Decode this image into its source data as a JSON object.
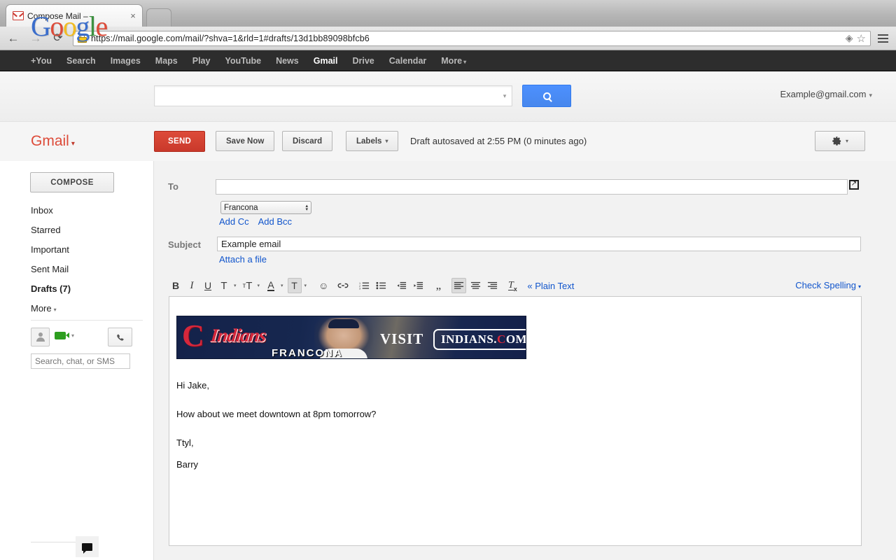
{
  "browser": {
    "tab_title": "Compose Mail –",
    "tab_close": "×",
    "back": "←",
    "forward": "→",
    "reload": "⟳",
    "url": "https://mail.google.com/mail/?shva=1&rld=1#drafts/13d1bb89098bfcb6",
    "bookmark_star": "☆",
    "extension_icon": "◈",
    "favicon_name": "gmail-favicon"
  },
  "gbar": {
    "links": [
      {
        "label": "+You",
        "active": false
      },
      {
        "label": "Search",
        "active": false
      },
      {
        "label": "Images",
        "active": false
      },
      {
        "label": "Maps",
        "active": false
      },
      {
        "label": "Play",
        "active": false
      },
      {
        "label": "YouTube",
        "active": false
      },
      {
        "label": "News",
        "active": false
      },
      {
        "label": "Gmail",
        "active": true
      },
      {
        "label": "Drive",
        "active": false
      },
      {
        "label": "Calendar",
        "active": false
      },
      {
        "label": "More",
        "active": false,
        "caret": true
      }
    ],
    "caret": "▾"
  },
  "header": {
    "logo_letters": [
      {
        "ch": "G",
        "color": "blue"
      },
      {
        "ch": "o",
        "color": "red"
      },
      {
        "ch": "o",
        "color": "yellow"
      },
      {
        "ch": "g",
        "color": "blue"
      },
      {
        "ch": "l",
        "color": "green"
      },
      {
        "ch": "e",
        "color": "red"
      }
    ],
    "search_value": "",
    "search_placeholder": "",
    "search_button_icon": "search-icon",
    "account": "Example@gmail.com",
    "account_caret": "▾"
  },
  "actionbar": {
    "gmail_label": "Gmail",
    "gmail_caret": "▾",
    "send_label": "SEND",
    "save_label": "Save Now",
    "discard_label": "Discard",
    "labels_label": "Labels",
    "labels_caret": "▾",
    "autosave_text": "Draft autosaved at 2:55 PM (0 minutes ago)",
    "settings_icon": "gear-icon",
    "settings_caret": "▾"
  },
  "sidebar": {
    "compose_label": "COMPOSE",
    "items": [
      {
        "label": "Inbox",
        "bold": false
      },
      {
        "label": "Starred",
        "bold": false
      },
      {
        "label": "Important",
        "bold": false
      },
      {
        "label": "Sent Mail",
        "bold": false
      },
      {
        "label": "Drafts (7)",
        "bold": true
      },
      {
        "label": "More",
        "bold": false,
        "caret": true
      }
    ],
    "more_caret": "▾",
    "chat_search_placeholder": "Search, chat, or SMS",
    "chat_search_value": "",
    "video_caret": "▾",
    "phone_icon": "phone-icon",
    "chat_bubble_icon": "chat-bubble-icon"
  },
  "compose": {
    "to_label": "To",
    "to_value": "",
    "to_placeholder": "",
    "popout_icon": "popout-icon",
    "from_select_value": "Francona",
    "add_cc": "Add Cc",
    "add_bcc": "Add Bcc",
    "subject_label": "Subject",
    "subject_value": "Example email",
    "attach_label": "Attach a file",
    "plain_text_label": "« Plain Text",
    "check_spelling_label": "Check Spelling",
    "check_spelling_caret": "▾",
    "toolbar": [
      {
        "name": "bold-icon",
        "glyph": "B",
        "style": "bold",
        "caret": false,
        "active": false
      },
      {
        "name": "italic-icon",
        "glyph": "I",
        "style": "italic",
        "caret": false,
        "active": false
      },
      {
        "name": "underline-icon",
        "glyph": "U",
        "style": "underline",
        "caret": false,
        "active": false
      },
      {
        "name": "font-family-icon",
        "glyph": "T",
        "style": "plain",
        "caret": true,
        "active": false
      },
      {
        "name": "font-size-icon",
        "glyph": "ᴛT",
        "style": "plain",
        "caret": true,
        "active": false
      },
      {
        "name": "text-color-icon",
        "glyph": "A",
        "style": "colorA",
        "caret": true,
        "active": false
      },
      {
        "name": "highlight-color-icon",
        "glyph": "T",
        "style": "plain",
        "caret": true,
        "active": true
      },
      {
        "name": "emoji-icon",
        "glyph": "☺",
        "style": "plain",
        "caret": false,
        "active": false
      },
      {
        "name": "insert-link-icon",
        "glyph": "∞",
        "style": "link",
        "caret": false,
        "active": false
      },
      {
        "name": "numbered-list-icon",
        "glyph": "list-ol",
        "style": "svg",
        "caret": false,
        "active": false
      },
      {
        "name": "bulleted-list-icon",
        "glyph": "list-ul",
        "style": "svg",
        "caret": false,
        "active": false
      },
      {
        "name": "outdent-icon",
        "glyph": "outdent",
        "style": "svg",
        "caret": false,
        "active": false
      },
      {
        "name": "indent-icon",
        "glyph": "indent",
        "style": "svg",
        "caret": false,
        "active": false
      },
      {
        "name": "quote-icon",
        "glyph": "❞",
        "style": "quote",
        "caret": false,
        "active": false
      },
      {
        "name": "align-left-icon",
        "glyph": "align-left",
        "style": "svg",
        "caret": false,
        "active": true
      },
      {
        "name": "align-center-icon",
        "glyph": "align-center",
        "style": "svg",
        "caret": false,
        "active": false
      },
      {
        "name": "align-right-icon",
        "glyph": "align-right",
        "style": "svg",
        "caret": false,
        "active": false
      },
      {
        "name": "remove-formatting-icon",
        "glyph": "Tx",
        "style": "removefmt",
        "caret": false,
        "active": false
      }
    ],
    "body": {
      "banner": {
        "team_initial": "C",
        "team_name": "Indians",
        "manager_name": "FRANCONA",
        "visit_text": "VISIT",
        "site_pre": "INDIANS.",
        "site_c": "C",
        "site_post": "OM",
        "alt": "Cleveland Indians Francona banner"
      },
      "paragraphs": [
        "Hi Jake,",
        "How about we meet downtown at 8pm tomorrow?",
        "Ttyl,",
        "Barry"
      ]
    }
  },
  "colors": {
    "gmail_red": "#dd4b39",
    "link_blue": "#1155cc",
    "google_blue": "#3b6ecc",
    "google_green": "#3d9140",
    "google_yellow": "#f1bc22",
    "banner_navy": "#14224a",
    "chat_green": "#2d9e1f"
  }
}
